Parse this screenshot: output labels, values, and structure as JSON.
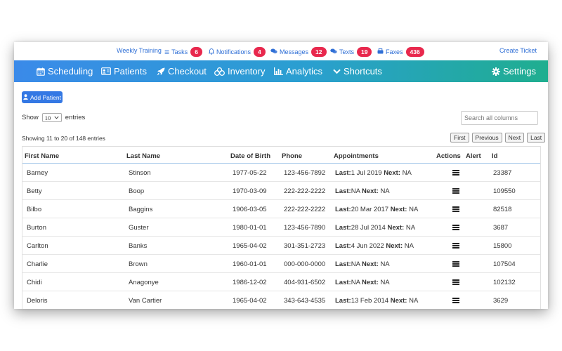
{
  "topbar": {
    "weekly_training": "Weekly Training",
    "tasks": {
      "label": "Tasks",
      "count": "6"
    },
    "notifications": {
      "label": "Notifications",
      "count": "4"
    },
    "messages": {
      "label": "Messages",
      "count": "12"
    },
    "texts": {
      "label": "Texts",
      "count": "19"
    },
    "faxes": {
      "label": "Faxes",
      "count": "436"
    },
    "create_ticket": "Create Ticket"
  },
  "nav": {
    "scheduling": "Scheduling",
    "patients": "Patients",
    "checkout": "Checkout",
    "inventory": "Inventory",
    "analytics": "Analytics",
    "shortcuts": "Shortcuts",
    "settings": "Settings"
  },
  "controls": {
    "add_patient": "Add Patient",
    "show_label": "Show",
    "entries_value": "10",
    "entries_label": "entries",
    "search_placeholder": "Search all columns",
    "info": "Showing 11 to 20 of 148 entries",
    "pager": {
      "first": "First",
      "previous": "Previous",
      "next": "Next",
      "last": "Last"
    }
  },
  "table": {
    "headers": {
      "first_name": "First Name",
      "last_name": "Last Name",
      "dob": "Date of Birth",
      "phone": "Phone",
      "appointments": "Appointments",
      "actions": "Actions",
      "alert": "Alert",
      "id": "Id"
    },
    "last_label": "Last:",
    "next_label": "Next:",
    "rows": [
      {
        "first": "Barney",
        "last": "Stinson",
        "dob": "1977-05-22",
        "phone": "123-456-7892",
        "appt_last": "1 Jul 2019",
        "appt_next": "NA",
        "id": "23387"
      },
      {
        "first": "Betty",
        "last": "Boop",
        "dob": "1970-03-09",
        "phone": "222-222-2222",
        "appt_last": "NA",
        "appt_next": "NA",
        "id": "109550"
      },
      {
        "first": "Bilbo",
        "last": "Baggins",
        "dob": "1906-03-05",
        "phone": "222-222-2222",
        "appt_last": "20 Mar 2017",
        "appt_next": "NA",
        "id": "82518"
      },
      {
        "first": "Burton",
        "last": "Guster",
        "dob": "1980-01-01",
        "phone": "123-456-7890",
        "appt_last": "28 Jul 2014",
        "appt_next": "NA",
        "id": "3687"
      },
      {
        "first": "Carlton",
        "last": "Banks",
        "dob": "1965-04-02",
        "phone": "301-351-2723",
        "appt_last": "4 Jun 2022",
        "appt_next": "NA",
        "id": "15800"
      },
      {
        "first": "Charlie",
        "last": "Brown",
        "dob": "1960-01-01",
        "phone": "000-000-0000",
        "appt_last": "NA",
        "appt_next": "NA",
        "id": "107504"
      },
      {
        "first": "Chidi",
        "last": "Anagonye",
        "dob": "1986-12-02",
        "phone": "404-931-6502",
        "appt_last": "NA",
        "appt_next": "NA",
        "id": "102132"
      },
      {
        "first": "Deloris",
        "last": "Van Cartier",
        "dob": "1965-04-02",
        "phone": "343-643-4535",
        "appt_last": "13 Feb 2014",
        "appt_next": "NA",
        "id": "3629"
      }
    ]
  },
  "colors": {
    "badge": "#e8284d",
    "link": "#2f6fd6",
    "nav_start": "#3a8ae9",
    "nav_end": "#1fae8f",
    "button": "#3478e4"
  }
}
